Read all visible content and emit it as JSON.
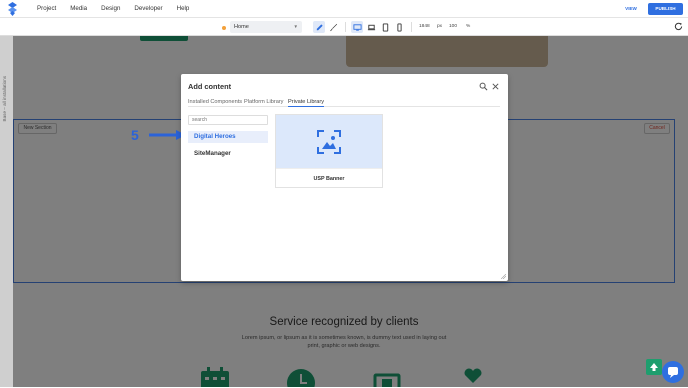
{
  "topbar": {
    "menu": [
      "Project",
      "Media",
      "Design",
      "Developer",
      "Help"
    ],
    "view_label": "VIEW",
    "publish_label": "PUBLISH"
  },
  "toolbar": {
    "page_select": "Home",
    "width_value": "1848",
    "width_unit": "px",
    "zoom_value": "100",
    "zoom_unit": "%"
  },
  "left_panel": {
    "vertical_text": "Base – all installations"
  },
  "canvas": {
    "new_section_label": "New Section",
    "cancel_label": "Cancel",
    "service_title": "Service recognized by clients",
    "service_text": "Lorem ipsum, or lipsum as it is sometimes known, is dummy text used in laying out print, graphic or web designs."
  },
  "annotation": {
    "step_number": "5"
  },
  "modal": {
    "title": "Add content",
    "tabs": [
      "Installed Components",
      "Platform Library",
      "Private Library"
    ],
    "active_tab": "Private Library",
    "search_placeholder": "search",
    "libraries": [
      "Digital Heroes",
      "SiteManager"
    ],
    "selected_library": "Digital Heroes",
    "cards": [
      {
        "label": "USP Banner",
        "icon": "image-icon"
      }
    ]
  },
  "colors": {
    "accent": "#2f6fe0",
    "green": "#1e9e6e",
    "annotation_blue": "#2b63d9",
    "cancel_red": "#e04a3a"
  }
}
